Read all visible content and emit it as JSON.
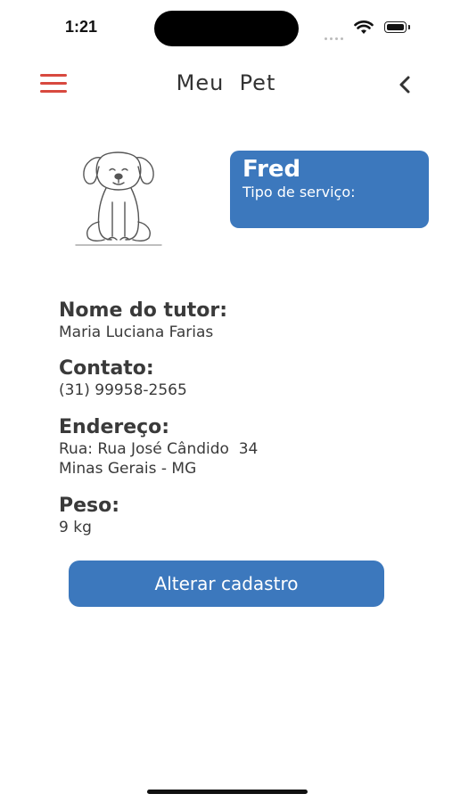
{
  "status_bar": {
    "time": "1:21"
  },
  "header": {
    "title": "Meu  Pet"
  },
  "pet_card": {
    "name": "Fred",
    "service_label": "Tipo de serviço:"
  },
  "details": {
    "tutor_label": "Nome do tutor:",
    "tutor_value": "Maria Luciana Farias",
    "contact_label": "Contato:",
    "contact_value": "(31) 99958-2565",
    "address_label": "Endereço:",
    "address_line1": "Rua: Rua José Cândido  34",
    "address_line2": "Minas Gerais - MG",
    "weight_label": "Peso:",
    "weight_value": "9 kg"
  },
  "actions": {
    "edit_label": "Alterar cadastro"
  },
  "colors": {
    "accent_blue": "#3c78bd",
    "menu_red": "#d8493f"
  },
  "icons": {
    "menu": "hamburger-menu-icon",
    "back": "chevron-left-icon",
    "pet": "dog-illustration"
  }
}
